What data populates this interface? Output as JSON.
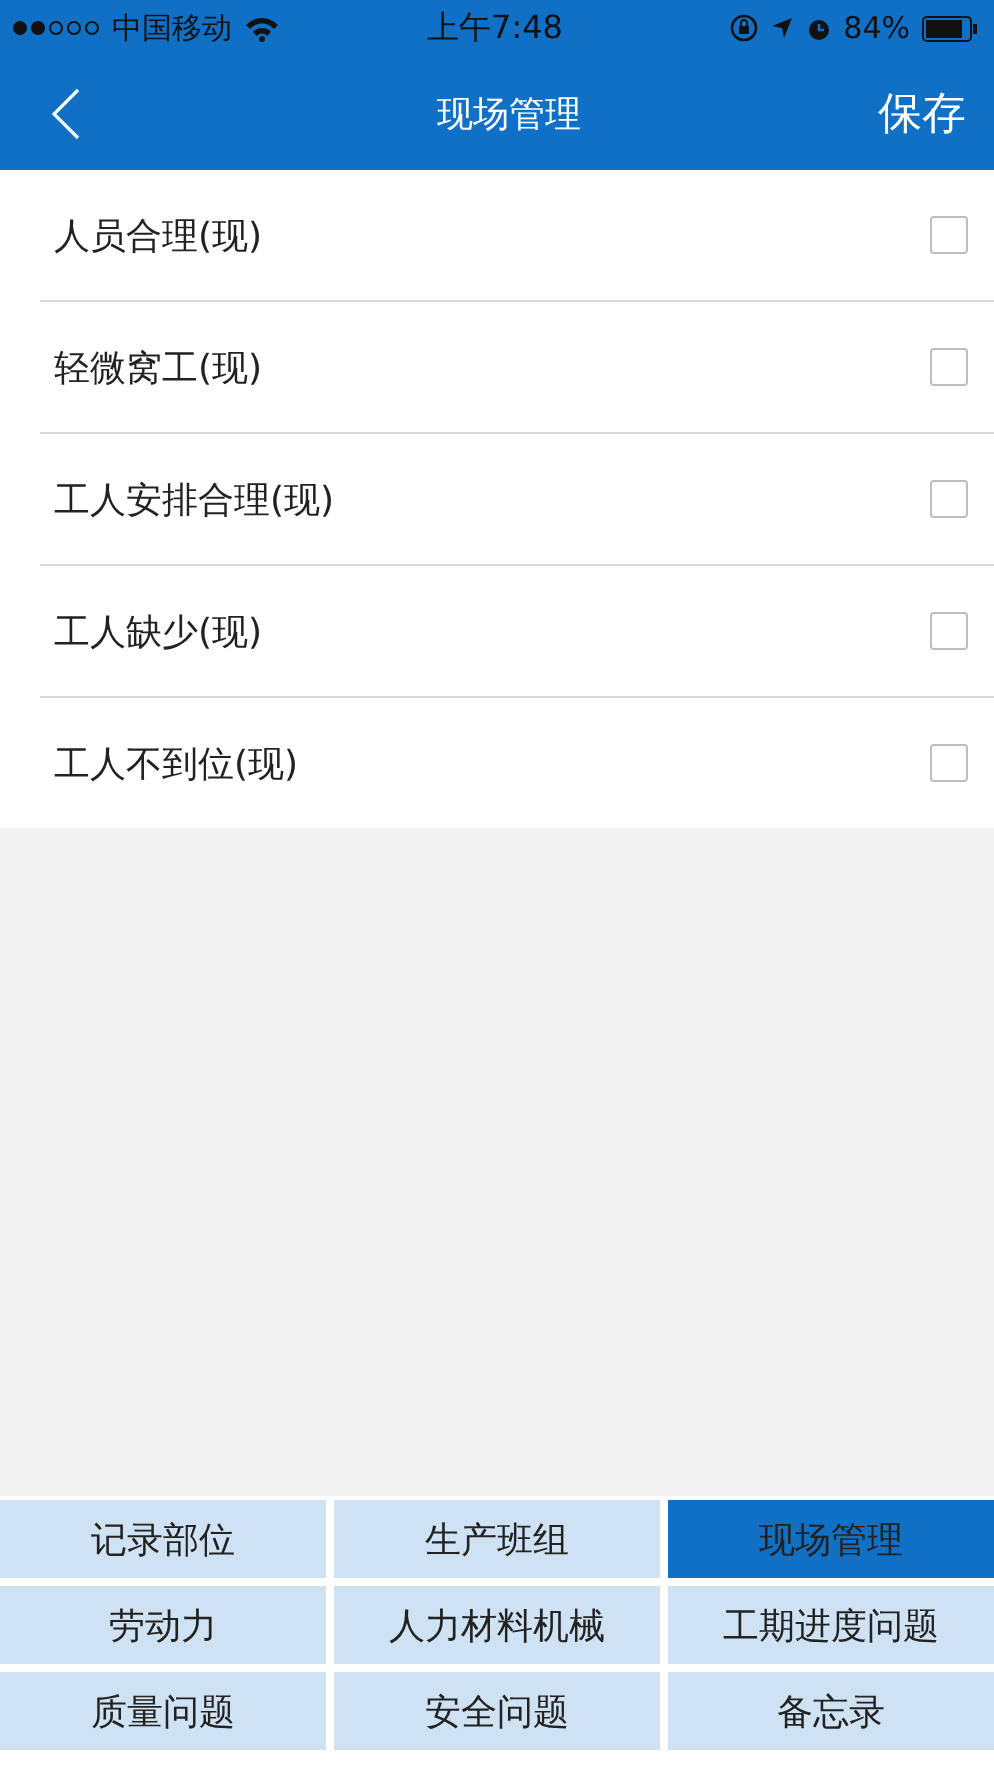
{
  "status_bar": {
    "carrier": "中国移动",
    "time": "上午7:48",
    "battery": "84%"
  },
  "nav": {
    "title": "现场管理",
    "action": "保存"
  },
  "items": [
    {
      "label": "人员合理(现)",
      "checked": false
    },
    {
      "label": "轻微窝工(现)",
      "checked": false
    },
    {
      "label": "工人安排合理(现)",
      "checked": false
    },
    {
      "label": "工人缺少(现)",
      "checked": false
    },
    {
      "label": "工人不到位(现)",
      "checked": false
    }
  ],
  "tabs": [
    {
      "label": "记录部位",
      "selected": false
    },
    {
      "label": "生产班组",
      "selected": false
    },
    {
      "label": "现场管理",
      "selected": true
    },
    {
      "label": "劳动力",
      "selected": false
    },
    {
      "label": "人力材料机械",
      "selected": false
    },
    {
      "label": "工期进度问题",
      "selected": false
    },
    {
      "label": "质量问题",
      "selected": false
    },
    {
      "label": "安全问题",
      "selected": false
    },
    {
      "label": "备忘录",
      "selected": false
    }
  ]
}
